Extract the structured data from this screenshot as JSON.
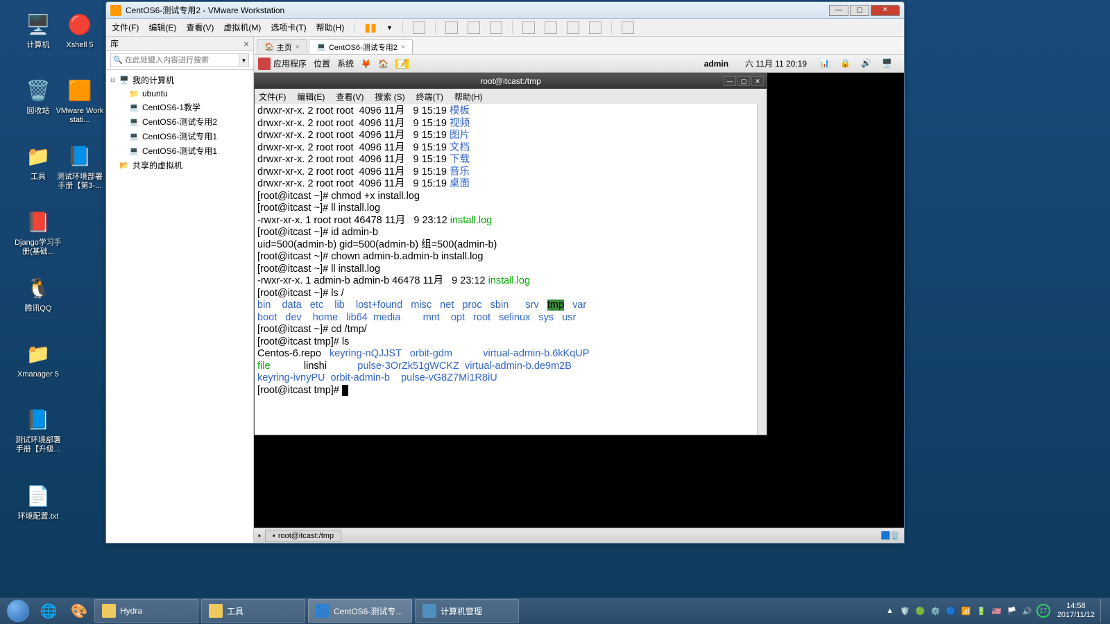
{
  "desktop": {
    "icons": [
      {
        "label": "计算机",
        "glyph": "🖥️"
      },
      {
        "label": "Xshell 5",
        "glyph": "🔴"
      },
      {
        "label": "回收站",
        "glyph": "🗑️"
      },
      {
        "label": "VMware Workstati...",
        "glyph": "🟧"
      },
      {
        "label": "工具",
        "glyph": "📁"
      },
      {
        "label": "测试环境部署手册【第3-...",
        "glyph": "📘"
      },
      {
        "label": "Django学习手册(基础...",
        "glyph": "📕"
      },
      {
        "label": "腾讯QQ",
        "glyph": "🐧"
      },
      {
        "label": "Xmanager 5",
        "glyph": "📁"
      },
      {
        "label": "测试环境部署手册【升级...",
        "glyph": "📘"
      },
      {
        "label": "环境配置.txt",
        "glyph": "📄"
      }
    ]
  },
  "vmware": {
    "title": "CentOS6-测试专用2 - VMware Workstation",
    "menu": [
      "文件(F)",
      "编辑(E)",
      "查看(V)",
      "虚拟机(M)",
      "选项卡(T)",
      "帮助(H)"
    ],
    "lib": {
      "title": "库",
      "search_placeholder": "在此处键入内容进行搜索",
      "tree": [
        {
          "label": "我的计算机",
          "indent": 0,
          "exp": "⊟",
          "icon": "🖥️"
        },
        {
          "label": "ubuntu",
          "indent": 1,
          "icon": "📁"
        },
        {
          "label": "CentOS6-1教学",
          "indent": 1,
          "icon": "💻"
        },
        {
          "label": "CentOS6-测试专用2",
          "indent": 1,
          "icon": "💻"
        },
        {
          "label": "CentOS6-测试专用1",
          "indent": 1,
          "icon": "💻"
        },
        {
          "label": "CentOS6-测试专用1",
          "indent": 1,
          "icon": "💻"
        },
        {
          "label": "共享的虚拟机",
          "indent": 0,
          "exp": "",
          "icon": "📂"
        }
      ]
    },
    "tabs": [
      {
        "label": "主页",
        "icon": "🏠",
        "active": false
      },
      {
        "label": "CentOS6-测试专用2",
        "icon": "💻",
        "active": true
      }
    ],
    "gnome_top": {
      "apps": "应用程序",
      "places": "位置",
      "system": "系统",
      "user": "admin",
      "date": "六 11月  11 20:19"
    },
    "terminal": {
      "title": "root@itcast:/tmp",
      "menu": [
        "文件(F)",
        "编辑(E)",
        "查看(V)",
        "搜索 (S)",
        "终端(T)",
        "帮助(H)"
      ],
      "ls_dirs": [
        {
          "perm": "drwxr-xr-x. 2 root root  4096 11月   9 15:19 ",
          "name": "模板"
        },
        {
          "perm": "drwxr-xr-x. 2 root root  4096 11月   9 15:19 ",
          "name": "视频"
        },
        {
          "perm": "drwxr-xr-x. 2 root root  4096 11月   9 15:19 ",
          "name": "图片"
        },
        {
          "perm": "drwxr-xr-x. 2 root root  4096 11月   9 15:19 ",
          "name": "文档"
        },
        {
          "perm": "drwxr-xr-x. 2 root root  4096 11月   9 15:19 ",
          "name": "下载"
        },
        {
          "perm": "drwxr-xr-x. 2 root root  4096 11月   9 15:19 ",
          "name": "音乐"
        },
        {
          "perm": "drwxr-xr-x. 2 root root  4096 11月   9 15:19 ",
          "name": "桌面"
        }
      ],
      "p1": "[root@itcast ~]# chmod +x install.log",
      "p2": "[root@itcast ~]# ll install.log",
      "ll1_a": "-rwxr-xr-x. 1 root root 46478 11月   9 23:12 ",
      "ll1_b": "install.log",
      "p3": "[root@itcast ~]# id admin-b",
      "id_out": "uid=500(admin-b) gid=500(admin-b) 组=500(admin-b)",
      "p4": "[root@itcast ~]# chown admin-b.admin-b install.log",
      "p5": "[root@itcast ~]# ll install.log",
      "ll2_a": "-rwxr-xr-x. 1 admin-b admin-b 46478 11月   9 23:12 ",
      "ll2_b": "install.log",
      "p6": "[root@itcast ~]# ls /",
      "root1": "bin    data   etc    lib    lost+found   misc   net   proc   sbin      srv   ",
      "root1_hl": "tmp",
      "root1_b": "   var",
      "root2": "boot   dev    home   lib64  media        mnt    opt   root   selinux   sys   usr",
      "p7": "[root@itcast ~]# cd /tmp/",
      "p8": "[root@itcast tmp]# ls",
      "tmp1_a": "Centos-6.repo   ",
      "tmp1_b": "keyring-nQJJST   orbit-gdm           virtual-admin-b.6kKqUP",
      "tmp2_a": "file",
      "tmp2_b": "            linshi           ",
      "tmp2_c": "pulse-3OrZk51gWCKZ  virtual-admin-b.de9m2B",
      "tmp3": "keyring-ivnyPU  orbit-admin-b    pulse-vG8Z7Mi1R8iU",
      "p9": "[root@itcast tmp]# "
    },
    "gnome_taskbar": {
      "item": "root@itcast:/tmp"
    }
  },
  "win_taskbar": {
    "items": [
      {
        "label": "Hydra",
        "color": "#f0c860"
      },
      {
        "label": "工具",
        "color": "#f0c860"
      },
      {
        "label": "CentOS6-测试专...",
        "color": "#3080d0",
        "active": true
      },
      {
        "label": "计算机管理",
        "color": "#5090c0"
      }
    ],
    "clock": {
      "time": "14:58",
      "date": "2017/11/12"
    }
  }
}
